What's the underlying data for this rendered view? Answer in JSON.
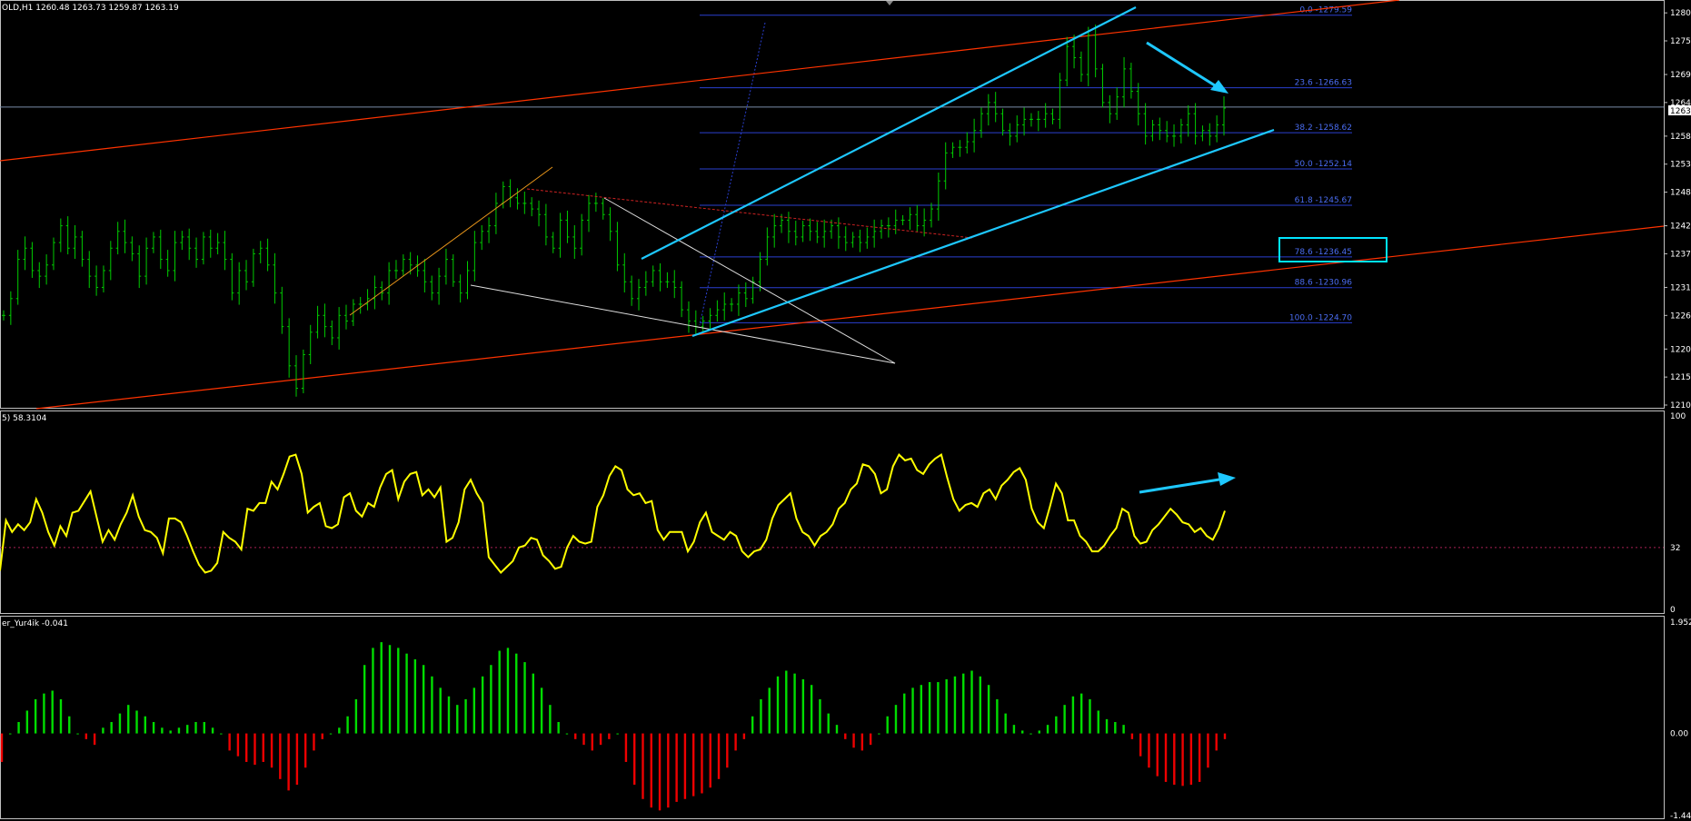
{
  "header": {
    "symbol_info": "OLD,H1  1260.48 1263.73 1259.87 1263.19"
  },
  "price_axis": {
    "ticks": [
      "1280",
      "1275",
      "1269",
      "1264",
      "1258",
      "1253",
      "1248",
      "1242",
      "1237",
      "1231",
      "1226",
      "1220",
      "1215",
      "1210"
    ],
    "current": "1263"
  },
  "fib": {
    "levels": [
      {
        "label": "0.0 -1279.59",
        "price": 1279.59
      },
      {
        "label": "23.6 -1266.63",
        "price": 1266.63
      },
      {
        "label": "38.2 -1258.62",
        "price": 1258.62
      },
      {
        "label": "50.0 -1252.14",
        "price": 1252.14
      },
      {
        "label": "61.8 -1245.67",
        "price": 1245.67
      },
      {
        "label": "78.6 -1236.45",
        "price": 1236.45
      },
      {
        "label": "88.6 -1230.96",
        "price": 1230.96
      },
      {
        "label": "100.0 -1224.70",
        "price": 1224.7
      }
    ]
  },
  "rsi": {
    "title": "5) 58.3104",
    "ticks": [
      "100",
      "32",
      "0"
    ]
  },
  "osc": {
    "title": "er_Yur4ik -0.041",
    "ticks": [
      "1.952",
      "0.00",
      "-1.44"
    ]
  },
  "colors": {
    "candle": "#00cc00",
    "fib": "#2a3fd0",
    "trend_cyan": "#1ec8ff",
    "channel_red": "#ff3300",
    "rsi": "#ffff00",
    "hist_up": "#00dd00",
    "hist_down": "#ee0000",
    "highlight": "#00e5ff"
  },
  "chart_data": [
    {
      "type": "candlestick",
      "title": "OLD,H1",
      "ylim": [
        1210,
        1281
      ],
      "close": [
        1226,
        1229,
        1236,
        1238,
        1234,
        1233,
        1235,
        1239,
        1242,
        1238,
        1240,
        1236,
        1233,
        1231,
        1234,
        1238,
        1241,
        1239,
        1237,
        1233,
        1238,
        1240,
        1236,
        1234,
        1239,
        1240,
        1238,
        1236,
        1240,
        1238,
        1239,
        1236,
        1230,
        1234,
        1232,
        1237,
        1238,
        1235,
        1230,
        1224,
        1217,
        1213,
        1219,
        1223,
        1226,
        1224,
        1222,
        1226,
        1225,
        1228,
        1228,
        1229,
        1231,
        1230,
        1234,
        1234,
        1236,
        1235,
        1234,
        1232,
        1230,
        1233,
        1236,
        1232,
        1230,
        1234,
        1239,
        1241,
        1242,
        1246,
        1249,
        1247,
        1246,
        1246,
        1245,
        1244,
        1240,
        1238,
        1243,
        1240,
        1238,
        1243,
        1246,
        1246,
        1244,
        1241,
        1235,
        1232,
        1229,
        1231,
        1232,
        1234,
        1232,
        1232,
        1231,
        1227,
        1225,
        1224,
        1225,
        1226,
        1227,
        1228,
        1228,
        1230,
        1229,
        1232,
        1236,
        1240,
        1242,
        1243,
        1241,
        1240,
        1242,
        1241,
        1240,
        1241,
        1242,
        1240,
        1239,
        1240,
        1239,
        1240,
        1241,
        1242,
        1242,
        1243,
        1243,
        1244,
        1242,
        1243,
        1245,
        1250,
        1255,
        1256,
        1256,
        1257,
        1259,
        1262,
        1264,
        1262,
        1259,
        1258,
        1260,
        1261,
        1261,
        1261,
        1262,
        1261,
        1268,
        1274,
        1272,
        1269,
        1276,
        1270,
        1264,
        1262,
        1265,
        1270,
        1266,
        1262,
        1258,
        1260,
        1259,
        1258,
        1258,
        1260,
        1262,
        1258,
        1259,
        1258,
        1260,
        1263
      ]
    },
    {
      "type": "line",
      "title": "5) 58.3104",
      "ylim": [
        0,
        100
      ],
      "values": [
        20,
        46,
        40,
        44,
        41,
        45,
        57,
        50,
        40,
        33,
        43,
        38,
        50,
        51,
        56,
        61,
        48,
        35,
        41,
        36,
        44,
        50,
        59,
        48,
        41,
        40,
        37,
        29,
        47,
        47,
        45,
        38,
        30,
        23,
        19,
        20,
        24,
        40,
        37,
        35,
        31,
        52,
        51,
        55,
        55,
        66,
        62,
        70,
        79,
        80,
        70,
        50,
        53,
        55,
        43,
        42,
        44,
        58,
        60,
        51,
        48,
        55,
        53,
        63,
        70,
        72,
        57,
        66,
        70,
        71,
        59,
        62,
        58,
        63,
        35,
        37,
        45,
        62,
        67,
        60,
        55,
        27,
        23,
        19,
        22,
        25,
        32,
        33,
        37,
        36,
        28,
        25,
        21,
        22,
        32,
        38,
        35,
        34,
        35,
        53,
        59,
        69,
        74,
        72,
        62,
        59,
        60,
        55,
        56,
        41,
        36,
        40,
        40,
        40,
        30,
        35,
        45,
        50,
        40,
        38,
        36,
        40,
        38,
        30,
        27,
        30,
        31,
        36,
        47,
        54,
        57,
        60,
        47,
        40,
        38,
        33,
        38,
        40,
        44,
        52,
        55,
        62,
        65,
        75,
        74,
        70,
        60,
        62,
        74,
        80,
        77,
        78,
        72,
        70,
        75,
        78,
        80,
        68,
        57,
        51,
        54,
        55,
        53,
        60,
        62,
        57,
        64,
        67,
        71,
        73,
        67,
        52,
        45,
        42,
        53,
        65,
        60,
        46,
        46,
        38,
        35,
        30,
        30,
        33,
        38,
        42,
        52,
        50,
        38,
        34,
        35,
        41,
        44,
        48,
        52,
        49,
        45,
        44,
        40,
        42,
        38,
        36,
        42,
        51
      ]
    },
    {
      "type": "bar",
      "title": "er_Yur4ik -0.041",
      "ylim": [
        -1.44,
        1.952
      ],
      "values": [
        -0.5,
        0,
        0.2,
        0.4,
        0.6,
        0.7,
        0.75,
        0.6,
        0.3,
        0,
        -0.1,
        -0.2,
        0.1,
        0.2,
        0.35,
        0.5,
        0.4,
        0.3,
        0.2,
        0.1,
        0.05,
        0.1,
        0.15,
        0.2,
        0.2,
        0.1,
        0,
        -0.3,
        -0.4,
        -0.5,
        -0.55,
        -0.5,
        -0.6,
        -0.8,
        -1,
        -0.9,
        -0.6,
        -0.3,
        -0.1,
        0,
        0.1,
        0.3,
        0.6,
        1.2,
        1.5,
        1.6,
        1.55,
        1.5,
        1.4,
        1.3,
        1.2,
        1,
        0.8,
        0.65,
        0.5,
        0.6,
        0.8,
        1,
        1.2,
        1.45,
        1.5,
        1.4,
        1.25,
        1.05,
        0.8,
        0.5,
        0.2,
        0,
        -0.1,
        -0.2,
        -0.3,
        -0.2,
        -0.1,
        0,
        -0.5,
        -0.9,
        -1.15,
        -1.3,
        -1.35,
        -1.3,
        -1.2,
        -1.15,
        -1.1,
        -1.05,
        -0.95,
        -0.8,
        -0.6,
        -0.3,
        -0.1,
        0.3,
        0.6,
        0.8,
        1,
        1.1,
        1.05,
        0.95,
        0.85,
        0.6,
        0.35,
        0.15,
        -0.1,
        -0.25,
        -0.3,
        -0.2,
        0,
        0.3,
        0.5,
        0.7,
        0.8,
        0.85,
        0.9,
        0.9,
        0.95,
        1,
        1.05,
        1.1,
        1,
        0.85,
        0.6,
        0.35,
        0.15,
        0.05,
        0,
        0.05,
        0.15,
        0.3,
        0.5,
        0.65,
        0.7,
        0.6,
        0.4,
        0.25,
        0.2,
        0.15,
        -0.1,
        -0.4,
        -0.6,
        -0.75,
        -0.85,
        -0.9,
        -0.92,
        -0.9,
        -0.85,
        -0.6,
        -0.3,
        -0.1
      ]
    }
  ]
}
